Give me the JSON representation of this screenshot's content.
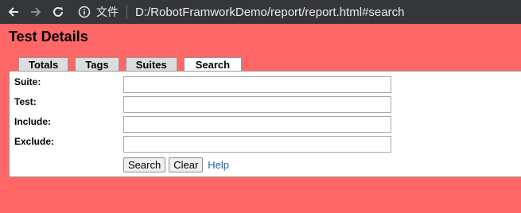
{
  "browser": {
    "site_label": "文件",
    "url": "D:/RobotFramworkDemo/report/report.html#search",
    "colors": {
      "toolbar": "#35363a",
      "text": "#e8eaed"
    },
    "icons": [
      "back-arrow-icon",
      "forward-arrow-icon",
      "reload-icon",
      "info-icon"
    ]
  },
  "page": {
    "title": "Test Details",
    "background": "#ff6666"
  },
  "tabs": [
    {
      "label": "Totals",
      "active": false
    },
    {
      "label": "Tags",
      "active": false
    },
    {
      "label": "Suites",
      "active": false
    },
    {
      "label": "Search",
      "active": true
    }
  ],
  "search_form": {
    "suite": {
      "label": "Suite:",
      "value": ""
    },
    "test": {
      "label": "Test:",
      "value": ""
    },
    "include": {
      "label": "Include:",
      "value": ""
    },
    "exclude": {
      "label": "Exclude:",
      "value": ""
    },
    "search_label": "Search",
    "clear_label": "Clear",
    "help_label": "Help"
  }
}
